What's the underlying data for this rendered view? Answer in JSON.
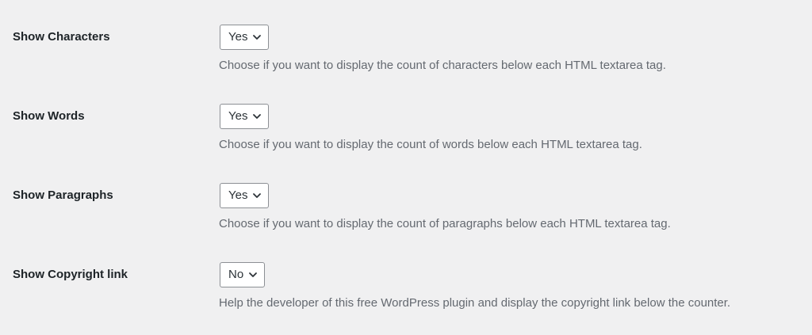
{
  "settings": [
    {
      "label": "Show Characters",
      "value": "Yes",
      "description": "Choose if you want to display the count of characters below each HTML textarea tag."
    },
    {
      "label": "Show Words",
      "value": "Yes",
      "description": "Choose if you want to display the count of words below each HTML textarea tag."
    },
    {
      "label": "Show Paragraphs",
      "value": "Yes",
      "description": "Choose if you want to display the count of paragraphs below each HTML textarea tag."
    },
    {
      "label": "Show Copyright link",
      "value": "No",
      "description": "Help the developer of this free WordPress plugin and display the copyright link below the counter."
    }
  ],
  "icons": {
    "select_arrow": "chevron-down-icon"
  },
  "colors": {
    "background": "#f0f0f1",
    "label_text": "#1d2327",
    "description_text": "#646970",
    "select_border": "#8c8f94"
  }
}
